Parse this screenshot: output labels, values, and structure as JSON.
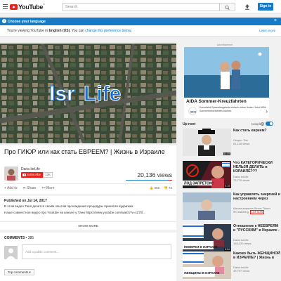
{
  "masthead": {
    "logo_text": "YouTube",
    "logo_country": "IL",
    "search_placeholder": "Search",
    "signin_label": "Sign in"
  },
  "language_banner": {
    "title": "Choose your language",
    "message_prefix": "You're viewing YouTube in ",
    "language": "English (US)",
    "message_mid": ". You can ",
    "change_link": "change this preference below",
    "message_suffix": ".",
    "learn_more": "Learn more"
  },
  "player": {
    "logo_text": "IsrLife",
    "logo_colors": [
      "#ffffff",
      "#1d6fd0"
    ]
  },
  "video": {
    "title": "Про ГИЮР или как стать ЕВРЕЕМ? | Жизнь в Израиле",
    "channel_name": "Daria IsrLife",
    "subscribe_label": "Subscribe",
    "subscriber_count": "13K",
    "views": "20,136 views",
    "actions": {
      "add_to": "Add to",
      "share": "Share",
      "more": "More"
    },
    "likes": "865",
    "dislikes": "73"
  },
  "description": {
    "published": "Published on Jul 14, 2017",
    "line1": "В этом видео Таня делится своим опытом прохождения процедуры принятия иудаизма.",
    "line2": "Наше совместное видео про Youtube на канале у Тани https://www.youtube.com/watch?v=cZ70l...",
    "show_more": "SHOW MORE"
  },
  "comments": {
    "header_label": "COMMENTS",
    "count": "385",
    "placeholder": "Add a public comment...",
    "sort_label": "Top comments"
  },
  "sidebar": {
    "ad_label": "Advertisement",
    "ad": {
      "title": "AIDA Sommer-Kreuzfahrten",
      "subtitle": "Kreuzfahrt-Spezialangebote einfach online finden. Jetzt AIDA Sommerkreuzfahrten buchen.",
      "logo_text": "AIDA"
    },
    "up_next": "Up next",
    "autoplay": "Autoplay",
    "related": [
      {
        "title": "Как стать евреем?",
        "channel": "Секрет Тов",
        "views": "61,145 views",
        "duration": "11:20",
        "live": false
      },
      {
        "title": "Что КАТЕГОРИЧЕСКИ НЕЛЬЗЯ ДЕЛАТЬ в ИЗРАИЛЕ???",
        "channel": "Daria IsrLife",
        "views": "73,770 views",
        "duration": "9:19",
        "thumb_text": "ЛОД ЗАПРЕТОМ!",
        "live": false
      },
      {
        "title": "Как управлять энергией и настроением через",
        "channel": "Школа анализа Литль Полчт",
        "views": "9K watching",
        "live_label": "LIVE NOW",
        "live": true
      },
      {
        "title": "Отношение к НЕЕВРЕЯМ и \"РУССКИМ\" в Израиле -",
        "channel": "Daria IsrLife",
        "views": "168,220 views",
        "duration": "8:54",
        "thumb_text": "НЕЕВРЕИ В ИЗРАИЛЕ",
        "live": false
      },
      {
        "title": "Каково быть ЖЕНЩИНОЙ в ИЗРАИЛЕ? | Жизнь в",
        "channel": "Daria IsrLife",
        "views": "49,797 views",
        "thumb_text": "ЖЕНЩИНЫ В ИЗРАИЛЕ",
        "live": false
      }
    ]
  }
}
